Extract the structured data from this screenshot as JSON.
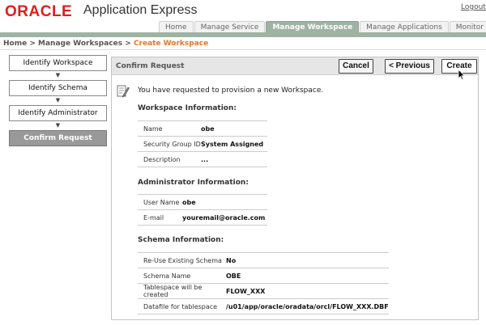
{
  "header": {
    "logo_text": "ORACLE",
    "app_title": "Application Express",
    "logout_label": "Logout",
    "tabs": [
      {
        "label": "Home"
      },
      {
        "label": "Manage Service"
      },
      {
        "label": "Manage Workspace"
      },
      {
        "label": "Manage Applications"
      },
      {
        "label": "Monitor Activ"
      }
    ]
  },
  "breadcrumb": {
    "home": "Home",
    "sep": ">",
    "parent": "Manage Workspaces",
    "current": "Create Workspace"
  },
  "wizard": {
    "steps": [
      {
        "label": "Identify Workspace"
      },
      {
        "label": "Identify Schema"
      },
      {
        "label": "Identify Administrator"
      },
      {
        "label": "Confirm Request"
      }
    ],
    "arrow_glyph": "▼"
  },
  "region": {
    "title": "Confirm Request",
    "cancel_label": "Cancel",
    "previous_label": "< Previous",
    "create_label": "Create",
    "intro": "You have requested to provision a new Workspace."
  },
  "workspace_info": {
    "title": "Workspace Information:",
    "rows": [
      {
        "key": "Name",
        "value": "obe"
      },
      {
        "key": "Security Group ID",
        "value": "System Assigned"
      },
      {
        "key": "Description",
        "value": "..."
      }
    ]
  },
  "admin_info": {
    "title": "Administrator Information:",
    "rows": [
      {
        "key": "User Name",
        "value": "obe"
      },
      {
        "key": "E-mail",
        "value": "youremail@oracle.com"
      }
    ]
  },
  "schema_info": {
    "title": "Schema Information:",
    "rows": [
      {
        "key": "Re-Use Existing Schema",
        "value": "No"
      },
      {
        "key": "Schema Name",
        "value": "OBE"
      },
      {
        "key": "Tablespace will be created",
        "value": "FLOW_XXX"
      },
      {
        "key": "Datafile for tablespace",
        "value": "/u01/app/oracle/oradata/orcl/FLOW_XXX.DBF"
      }
    ]
  }
}
